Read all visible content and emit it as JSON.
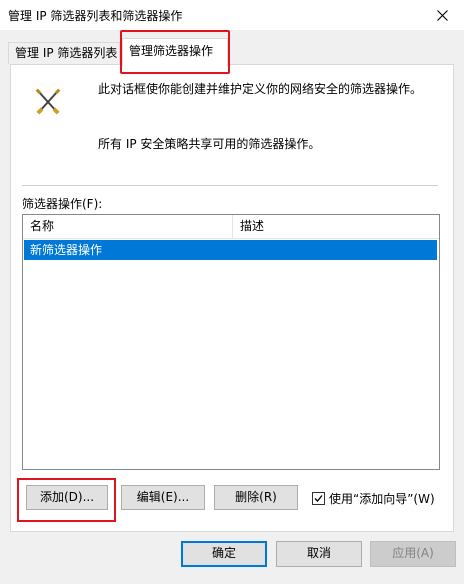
{
  "window": {
    "title": "管理 IP 筛选器列表和筛选器操作"
  },
  "tabs": [
    {
      "label": "管理 IP 筛选器列表"
    },
    {
      "label": "管理筛选器操作"
    }
  ],
  "intro": {
    "line1": "此对话框使你能创建并维护定义你的网络安全的筛选器操作。",
    "line2": "所有 IP 安全策略共享可用的筛选器操作。"
  },
  "filter_list": {
    "label": "筛选器操作(F):",
    "columns": [
      "名称",
      "描述"
    ],
    "rows": [
      {
        "name": "新筛选器操作",
        "description": ""
      }
    ]
  },
  "actions": {
    "add_label": "添加(D)...",
    "edit_label": "编辑(E)...",
    "delete_label": "删除(R)",
    "wizard_label": "使用“添加向导”(W)",
    "wizard_checked": true
  },
  "footer": {
    "ok_label": "确定",
    "cancel_label": "取消",
    "apply_label": "应用(A)"
  },
  "colors": {
    "selection": "#0078d7",
    "highlight_box": "#e0141f"
  },
  "icons": {
    "close": "close-icon",
    "tools": "crossed-tools-icon",
    "check": "checkmark-icon"
  }
}
